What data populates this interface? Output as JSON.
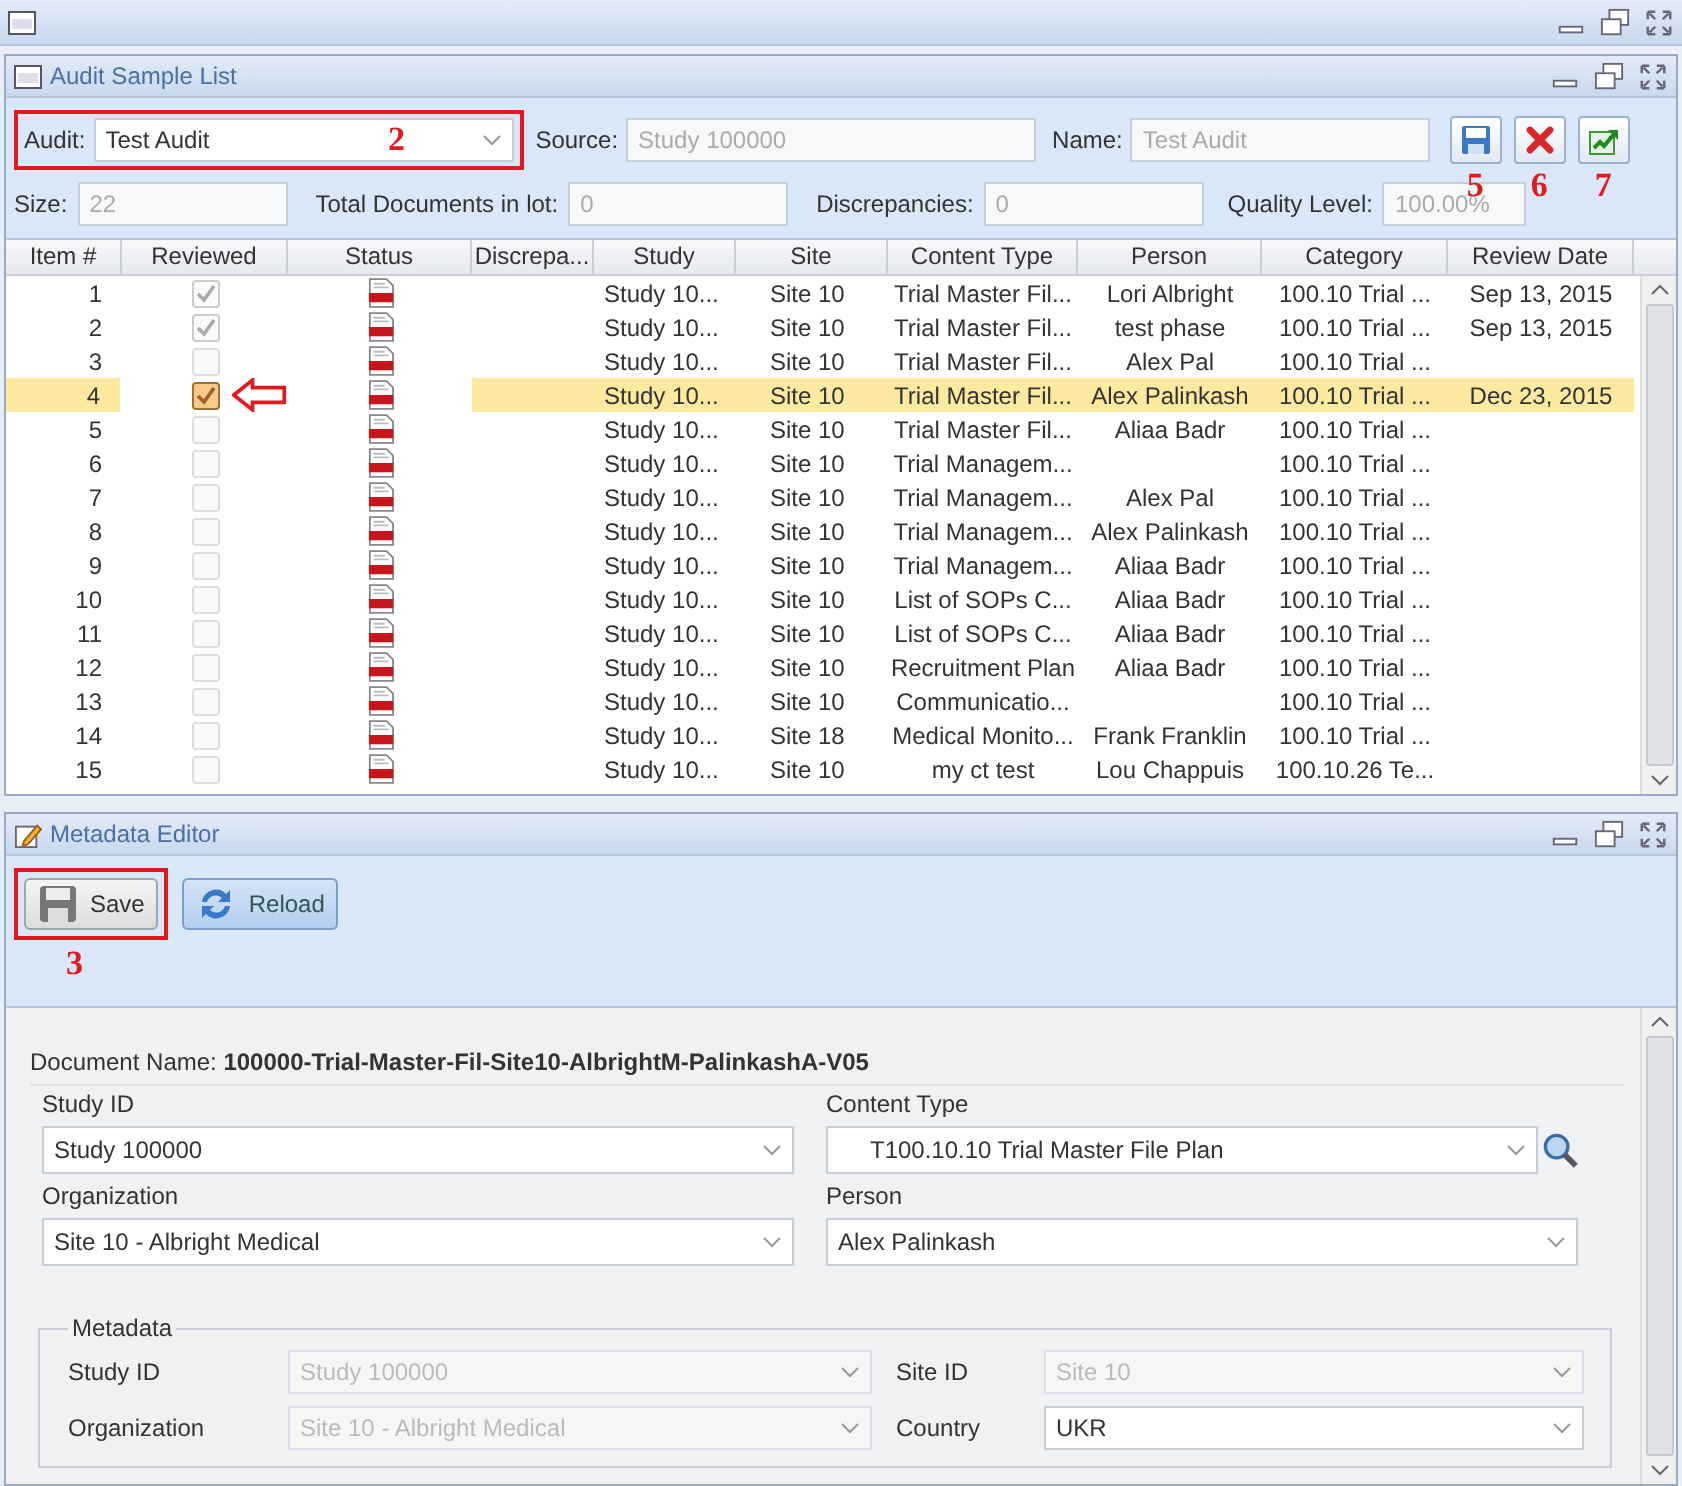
{
  "audit_panel": {
    "title": "Audit Sample List",
    "fields": [
      {
        "label": "Audit:",
        "value": "Test Audit",
        "kind": "select",
        "callout": "2"
      },
      {
        "label": "Source:",
        "value": "Study 100000",
        "kind": "readonly"
      },
      {
        "label": "Name:",
        "value": "Test Audit",
        "kind": "readonly"
      }
    ],
    "actions": [
      {
        "kind": "save",
        "callout": "5"
      },
      {
        "kind": "cancel",
        "callout": "6"
      },
      {
        "kind": "export",
        "callout": "7"
      }
    ],
    "stats": [
      {
        "label": "Size:",
        "value": "22"
      },
      {
        "label": "Total Documents in lot:",
        "value": "0"
      },
      {
        "label": "Discrepancies:",
        "value": "0"
      },
      {
        "label": "Quality Level:",
        "value": "100.00%"
      }
    ]
  },
  "grid": {
    "columns": [
      "Item #",
      "Reviewed",
      "Status",
      "Discrepa...",
      "Study",
      "Site",
      "Content Type",
      "Person",
      "Category",
      "Review Date"
    ],
    "rows": [
      {
        "item": "1",
        "reviewed": true,
        "selected": false,
        "study": "Study 10...",
        "site": "Site 10",
        "content_type": "Trial Master Fil...",
        "person": "Lori Albright",
        "category": "100.10 Trial ...",
        "review_date": "Sep 13, 2015"
      },
      {
        "item": "2",
        "reviewed": true,
        "selected": false,
        "study": "Study 10...",
        "site": "Site 10",
        "content_type": "Trial Master Fil...",
        "person": "test phase",
        "category": "100.10 Trial ...",
        "review_date": "Sep 13, 2015"
      },
      {
        "item": "3",
        "reviewed": false,
        "selected": false,
        "study": "Study 10...",
        "site": "Site 10",
        "content_type": "Trial Master Fil...",
        "person": "Alex Pal",
        "category": "100.10 Trial ..."
      },
      {
        "item": "4",
        "reviewed": true,
        "selected": true,
        "pointer": true,
        "study": "Study 10...",
        "site": "Site 10",
        "content_type": "Trial Master Fil...",
        "person": "Alex Palinkash",
        "category": "100.10 Trial ...",
        "review_date": "Dec 23, 2015"
      },
      {
        "item": "5",
        "reviewed": false,
        "selected": false,
        "study": "Study 10...",
        "site": "Site 10",
        "content_type": "Trial Master Fil...",
        "person": "Aliaa Badr",
        "category": "100.10 Trial ..."
      },
      {
        "item": "6",
        "reviewed": false,
        "selected": false,
        "study": "Study 10...",
        "site": "Site 10",
        "content_type": "Trial Managem...",
        "category": "100.10 Trial ..."
      },
      {
        "item": "7",
        "reviewed": false,
        "selected": false,
        "study": "Study 10...",
        "site": "Site 10",
        "content_type": "Trial Managem...",
        "person": "Alex Pal",
        "category": "100.10 Trial ..."
      },
      {
        "item": "8",
        "reviewed": false,
        "selected": false,
        "study": "Study 10...",
        "site": "Site 10",
        "content_type": "Trial Managem...",
        "person": "Alex Palinkash",
        "category": "100.10 Trial ..."
      },
      {
        "item": "9",
        "reviewed": false,
        "selected": false,
        "study": "Study 10...",
        "site": "Site 10",
        "content_type": "Trial Managem...",
        "person": "Aliaa Badr",
        "category": "100.10 Trial ..."
      },
      {
        "item": "10",
        "reviewed": false,
        "selected": false,
        "study": "Study 10...",
        "site": "Site 10",
        "content_type": "List of SOPs C...",
        "person": "Aliaa Badr",
        "category": "100.10 Trial ..."
      },
      {
        "item": "11",
        "reviewed": false,
        "selected": false,
        "study": "Study 10...",
        "site": "Site 10",
        "content_type": "List of SOPs C...",
        "person": "Aliaa Badr",
        "category": "100.10 Trial ..."
      },
      {
        "item": "12",
        "reviewed": false,
        "selected": false,
        "study": "Study 10...",
        "site": "Site 10",
        "content_type": "Recruitment Plan",
        "person": "Aliaa Badr",
        "category": "100.10 Trial ..."
      },
      {
        "item": "13",
        "reviewed": false,
        "selected": false,
        "study": "Study 10...",
        "site": "Site 10",
        "content_type": "Communicatio...",
        "category": "100.10 Trial ..."
      },
      {
        "item": "14",
        "reviewed": false,
        "selected": false,
        "study": "Study 10...",
        "site": "Site 18",
        "content_type": "Medical Monito...",
        "person": "Frank Franklin",
        "category": "100.10 Trial ..."
      },
      {
        "item": "15",
        "reviewed": false,
        "selected": false,
        "study": "Study 10...",
        "site": "Site 10",
        "content_type": "my ct test",
        "person": "Lou Chappuis",
        "category": "100.10.26 Te..."
      }
    ]
  },
  "editor": {
    "title": "Metadata Editor",
    "toolbar": [
      {
        "label": "Save",
        "kind": "save",
        "callout": "3"
      },
      {
        "label": "Reload",
        "kind": "reload"
      }
    ],
    "document_name": {
      "label": "Document Name:",
      "value": "100000-Trial-Master-Fil-Site10-AlbrightM-PalinkashA-V05"
    },
    "fields": [
      {
        "label": "Study ID",
        "value": "Study 100000"
      },
      {
        "label": "Content Type",
        "value": "T100.10.10 Trial Master File Plan",
        "lookup": true
      },
      {
        "label": "Organization",
        "value": "Site 10 - Albright Medical"
      },
      {
        "label": "Person",
        "value": "Alex Palinkash"
      }
    ],
    "metadata": {
      "legend": "Metadata",
      "fields": [
        {
          "label": "Study ID",
          "value": "Study 100000",
          "disabled": true
        },
        {
          "label": "Site ID",
          "value": "Site 10",
          "disabled": true
        },
        {
          "label": "Organization",
          "value": "Site 10 - Albright Medical",
          "disabled": true
        },
        {
          "label": "Country",
          "value": "UKR",
          "disabled": false
        }
      ]
    }
  }
}
